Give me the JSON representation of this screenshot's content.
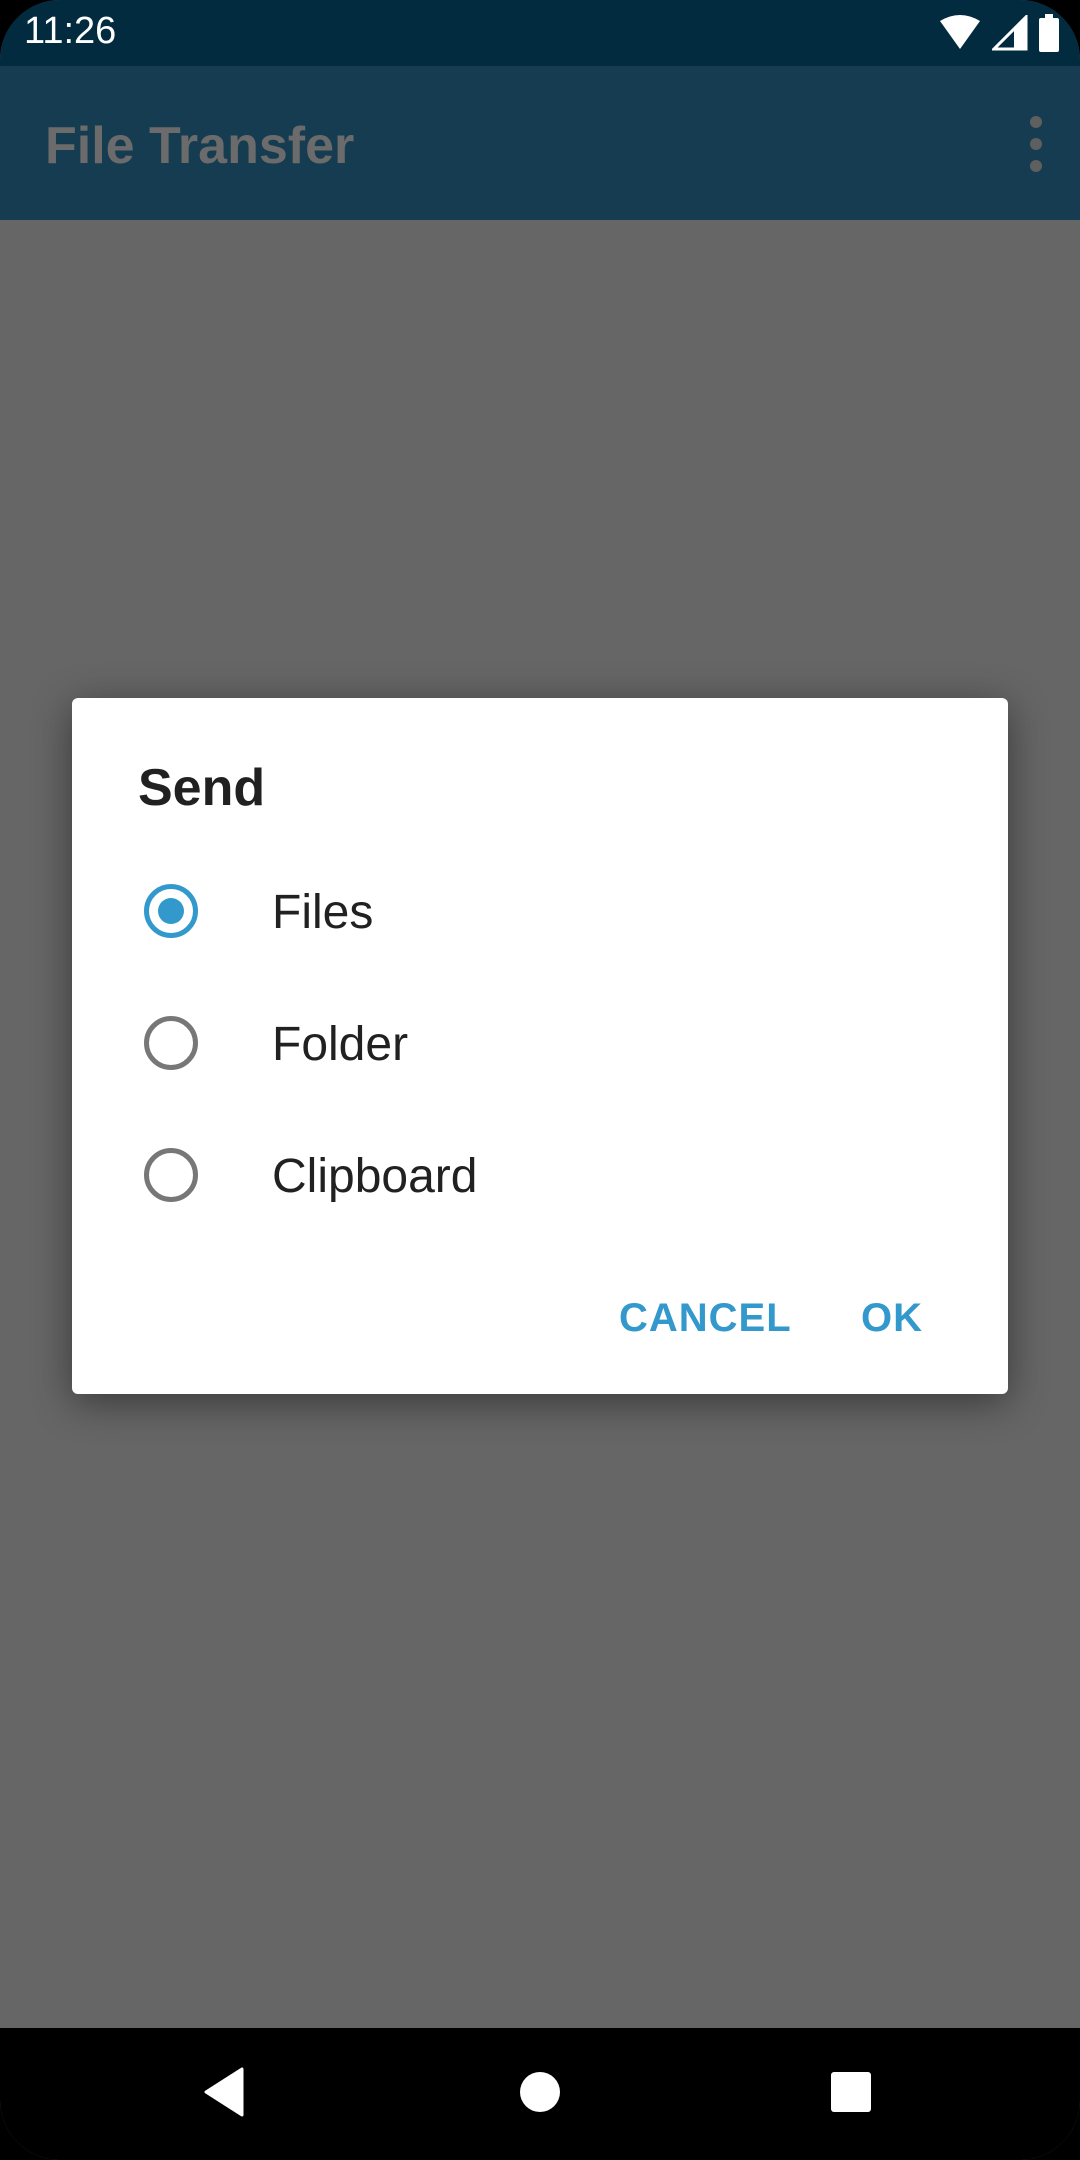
{
  "status_bar": {
    "time": "11:26",
    "icons": [
      "wifi-icon",
      "cell-signal-icon",
      "battery-icon"
    ]
  },
  "app_bar": {
    "title": "File Transfer",
    "overflow_icon": "more-vert-icon"
  },
  "dialog": {
    "title": "Send",
    "options": [
      {
        "label": "Files",
        "selected": true
      },
      {
        "label": "Folder",
        "selected": false
      },
      {
        "label": "Clipboard",
        "selected": false
      }
    ],
    "cancel_label": "CANCEL",
    "ok_label": "OK",
    "accent_color": "#3399cc"
  },
  "nav_bar": {
    "icons": [
      "back-icon",
      "home-icon",
      "recents-icon"
    ]
  }
}
